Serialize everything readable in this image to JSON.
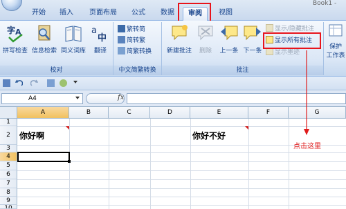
{
  "window": {
    "title_fragment": "Book1 -"
  },
  "tabs": [
    {
      "label": "开始"
    },
    {
      "label": "插入"
    },
    {
      "label": "页面布局"
    },
    {
      "label": "公式"
    },
    {
      "label": "数据"
    },
    {
      "label": "审阅",
      "active": true
    },
    {
      "label": "视图"
    }
  ],
  "ribbon": {
    "proofing": {
      "label": "校对",
      "spellcheck": "拼写检查",
      "research": "信息检索",
      "thesaurus": "同义词库",
      "translate": "翻译"
    },
    "chinese_conversion": {
      "label": "中文简繁转换",
      "to_simplified": "繁转简",
      "to_traditional": "简转繁",
      "convert": "简繁转换"
    },
    "comments": {
      "label": "批注",
      "new_comment": "新建批注",
      "delete": "删除",
      "previous": "上一条",
      "next": "下一条",
      "show_hide": "显示/隐藏批注",
      "show_all": "显示所有批注",
      "show_ink": "显示墨迹"
    },
    "changes": {
      "protect": "保护",
      "protect_sheet": "工作表"
    }
  },
  "formula_bar": {
    "name_box": "A4",
    "fx": "fx",
    "value": ""
  },
  "grid": {
    "columns": [
      "A",
      "B",
      "C",
      "D",
      "E",
      "F",
      "G"
    ],
    "rows": [
      "1",
      "2",
      "3",
      "4",
      "5",
      "6",
      "7",
      "8",
      "9",
      "10"
    ],
    "selected_cell": "A4",
    "cells": {
      "A2": "你好啊",
      "E2": "你好不好"
    }
  },
  "annotation": {
    "text": "点击这里"
  },
  "colors": {
    "highlight": "#e8141b",
    "ribbon_text": "#15428b"
  }
}
